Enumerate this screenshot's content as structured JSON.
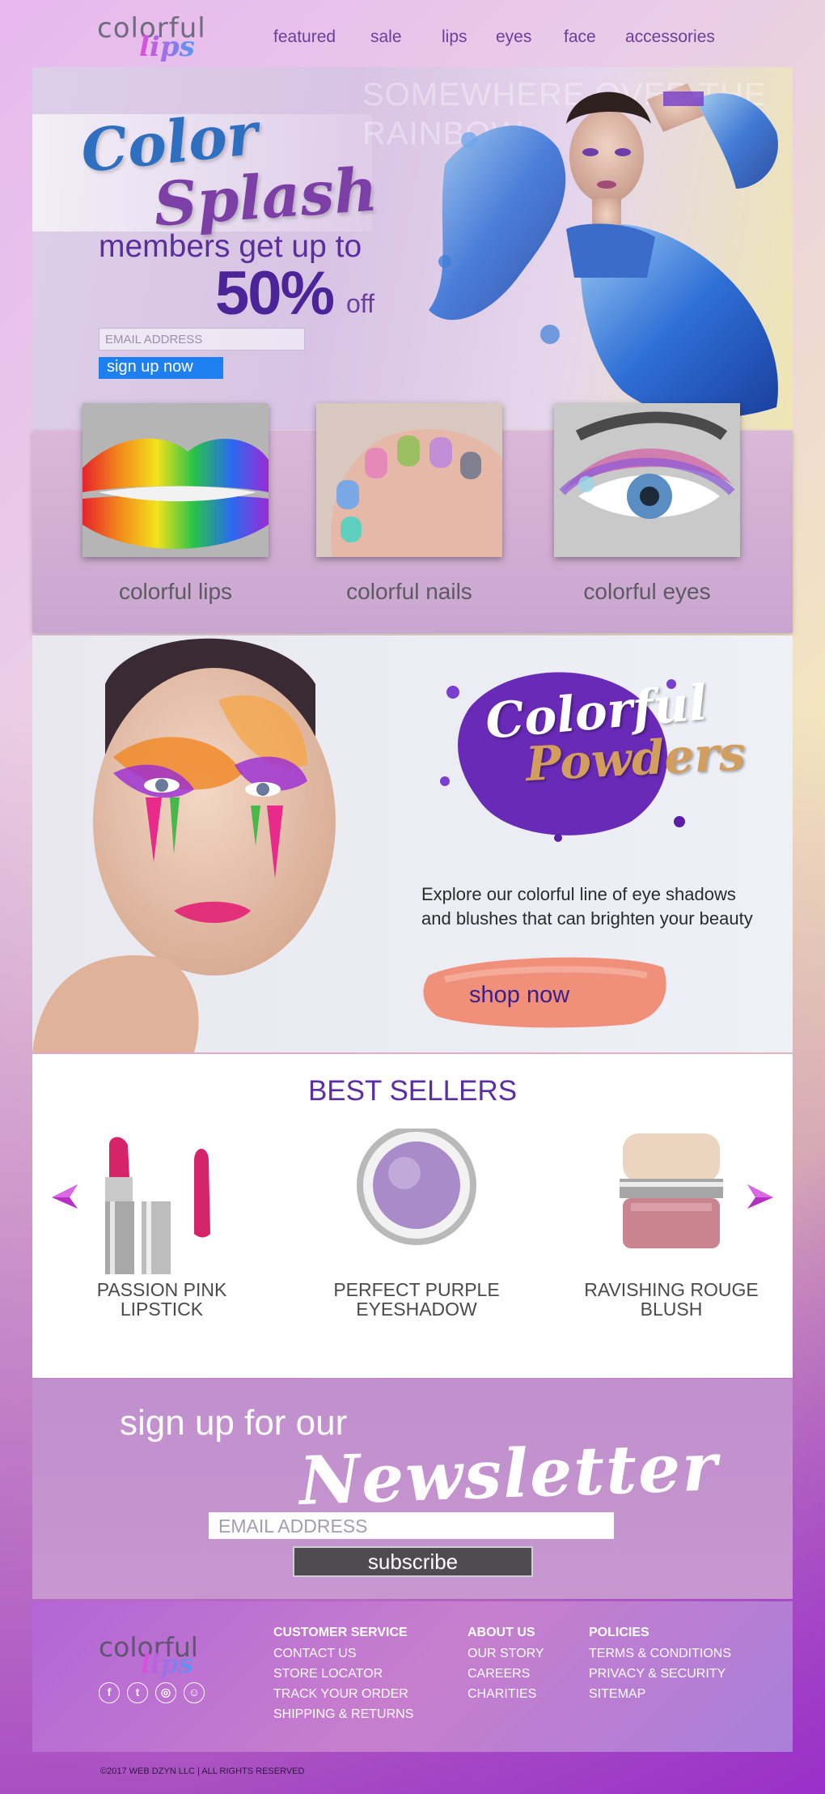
{
  "header": {
    "logo_text": "colorful",
    "logo_script": "lips",
    "nav": [
      "featured",
      "sale",
      "lips",
      "eyes",
      "face",
      "accessories"
    ]
  },
  "hero": {
    "script_line1": "Color",
    "script_line2": "Splash",
    "members_text": "members get up to",
    "percent": "50%",
    "off": "off",
    "email_placeholder": "EMAIL ADDRESS",
    "signup_label": "sign up now",
    "ghost_text": "SOMEWHERE OVER THE RAINBOW"
  },
  "categories": [
    {
      "label": "colorful lips",
      "icon": "rainbow-lips-image"
    },
    {
      "label": "colorful nails",
      "icon": "colorful-nails-image"
    },
    {
      "label": "colorful eyes",
      "icon": "colorful-eye-image"
    }
  ],
  "powders": {
    "script_line1": "Colorful",
    "script_line2": "Powders",
    "description_line1": "Explore our colorful line of eye shadows",
    "description_line2": "and blushes that can brighten your beauty",
    "shop_label": "shop now"
  },
  "best_sellers": {
    "title": "BEST SELLERS",
    "products": [
      {
        "name_line1": "PASSION PINK",
        "name_line2": "LIPSTICK"
      },
      {
        "name_line1": "PERFECT PURPLE",
        "name_line2": "EYESHADOW"
      },
      {
        "name_line1": "RAVISHING ROUGE",
        "name_line2": "BLUSH"
      }
    ]
  },
  "newsletter": {
    "line1": "sign up for our",
    "script": "Newsletter",
    "email_placeholder": "EMAIL ADDRESS",
    "subscribe_label": "subscribe"
  },
  "footer": {
    "logo_text": "colorful",
    "logo_script": "lips",
    "socials": [
      "f",
      "t",
      "◎",
      "☺"
    ],
    "columns": [
      {
        "heading": "CUSTOMER SERVICE",
        "items": [
          "CONTACT US",
          "STORE LOCATOR",
          "TRACK YOUR ORDER",
          "SHIPPING & RETURNS"
        ]
      },
      {
        "heading": "ABOUT US",
        "items": [
          "OUR STORY",
          "CAREERS",
          "CHARITIES"
        ]
      },
      {
        "heading": "POLICIES",
        "items": [
          "TERMS & CONDITIONS",
          "PRIVACY & SECURITY",
          "SITEMAP"
        ]
      }
    ],
    "copyright": "©2017 WEB DZYN LLC | ALL RIGHTS RESERVED"
  },
  "colors": {
    "accent_purple": "#5c2ea6",
    "signup_blue": "#1e7ff0",
    "subscribe_gray": "#4f4b50"
  }
}
